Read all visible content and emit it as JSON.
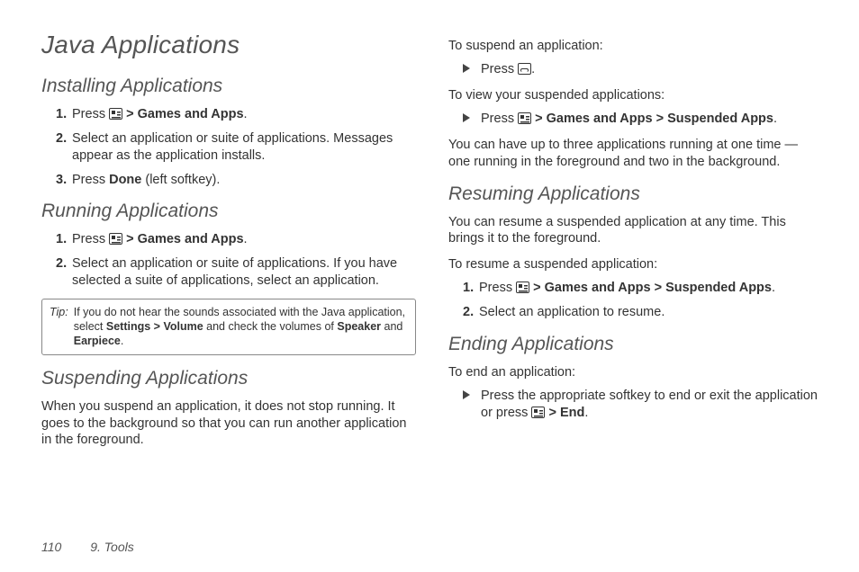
{
  "page": {
    "title": "Java Applications",
    "footer_page": "110",
    "footer_section": "9. Tools"
  },
  "left": {
    "h_install": "Installing Applications",
    "install_steps": {
      "s1a": "Press ",
      "s1b": "Games and Apps",
      "s1c": ".",
      "s2": "Select an application or suite of applications. Messages appear as the application installs.",
      "s3a": "Press ",
      "s3b": "Done",
      "s3c": " (left softkey)."
    },
    "h_run": "Running Applications",
    "run_steps": {
      "s1a": "Press ",
      "s1b": "Games and Apps",
      "s1c": ".",
      "s2": "Select an application or suite of applications. If you have selected a suite of applications, select an application."
    },
    "tip_label": "Tip:",
    "tip_a": "If you do not hear the sounds associated with the Java application, select ",
    "tip_b1": "Settings",
    "tip_b2": "Volume",
    "tip_c": " and check the volumes of ",
    "tip_d1": "Speaker",
    "tip_and": " and ",
    "tip_d2": "Earpiece",
    "tip_e": ".",
    "h_suspend": "Suspending Applications",
    "suspend_body": "When you suspend an application, it does not stop running. It goes to the background so that you can run another application in the foreground."
  },
  "right": {
    "lead_suspend": "To suspend an application:",
    "suspend_item_a": "Press ",
    "suspend_item_b": ".",
    "lead_view": "To view your suspended applications:",
    "view_item_a": "Press ",
    "view_item_b1": "Games and Apps",
    "view_item_b2": "Suspended Apps",
    "view_item_c": ".",
    "body_uptothree": "You can have up to three applications running at one time — one running in the foreground and two in the background.",
    "h_resume": "Resuming Applications",
    "resume_body": "You can resume a suspended application at any time. This brings it to the foreground.",
    "lead_resume": "To resume a suspended application:",
    "resume_steps": {
      "s1a": "Press ",
      "s1b1": "Games and Apps",
      "s1b2": "Suspended Apps",
      "s1c": ".",
      "s2": "Select an application to resume."
    },
    "h_end": "Ending Applications",
    "lead_end": "To end an application:",
    "end_item_a": "Press the appropriate softkey to end or exit the application or press ",
    "end_item_b": "End",
    "end_item_c": "."
  }
}
